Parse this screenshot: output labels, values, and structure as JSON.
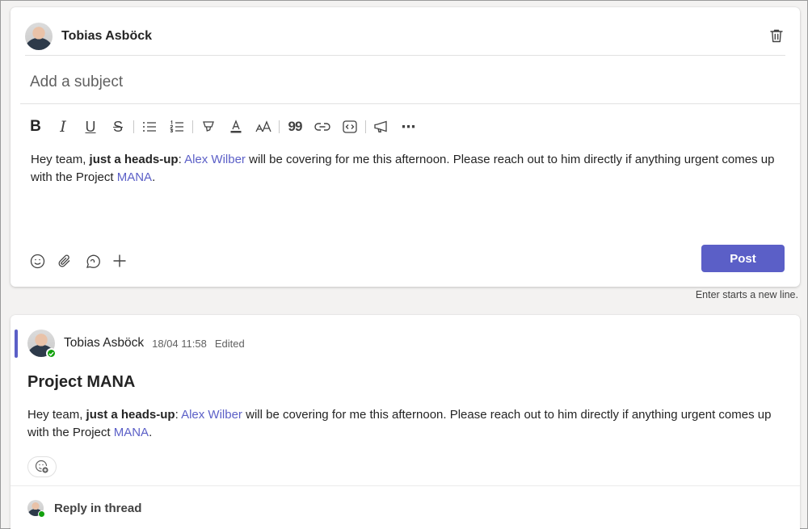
{
  "compose": {
    "author": "Tobias Asböck",
    "subject_placeholder": "Add a subject",
    "subject_value": "",
    "toolbar": {
      "bold": "B",
      "italic": "I",
      "underline": "U",
      "strikethrough": "S",
      "quote": "99",
      "more": "⋯"
    },
    "body": {
      "t1": "Hey team, ",
      "bold": "just a heads-up",
      "t2": ": ",
      "mention": "Alex Wilber",
      "t3": " will be covering for me this afternoon. Please reach out to him directly if anything urgent comes up with the Project ",
      "tag": "MANA",
      "t4": "."
    },
    "post_label": "Post",
    "hint": "Enter starts a new line."
  },
  "post": {
    "author": "Tobias Asböck",
    "time": "18/04 11:58",
    "edited": "Edited",
    "subject": "Project MANA",
    "body": {
      "t1": "Hey team, ",
      "bold": "just a heads-up",
      "t2": ": ",
      "mention": "Alex Wilber",
      "t3": " will be covering for me this afternoon. Please reach out to him directly if anything urgent comes up with the Project ",
      "tag": "MANA",
      "t4": "."
    },
    "reply_label": "Reply in thread"
  },
  "colors": {
    "accent": "#5b5fc7",
    "presence_available": "#13a10e"
  },
  "icons": {
    "compose": [
      "trash-icon",
      "bold-icon",
      "italic-icon",
      "underline-icon",
      "strikethrough-icon",
      "bulleted-list-icon",
      "numbered-list-icon",
      "highlight-icon",
      "font-color-icon",
      "font-size-icon",
      "quote-icon",
      "link-icon",
      "code-snippet-icon",
      "announcement-icon",
      "more-options-icon",
      "emoji-icon",
      "attach-icon",
      "loop-icon",
      "add-icon"
    ],
    "post": [
      "add-reaction-icon"
    ]
  }
}
